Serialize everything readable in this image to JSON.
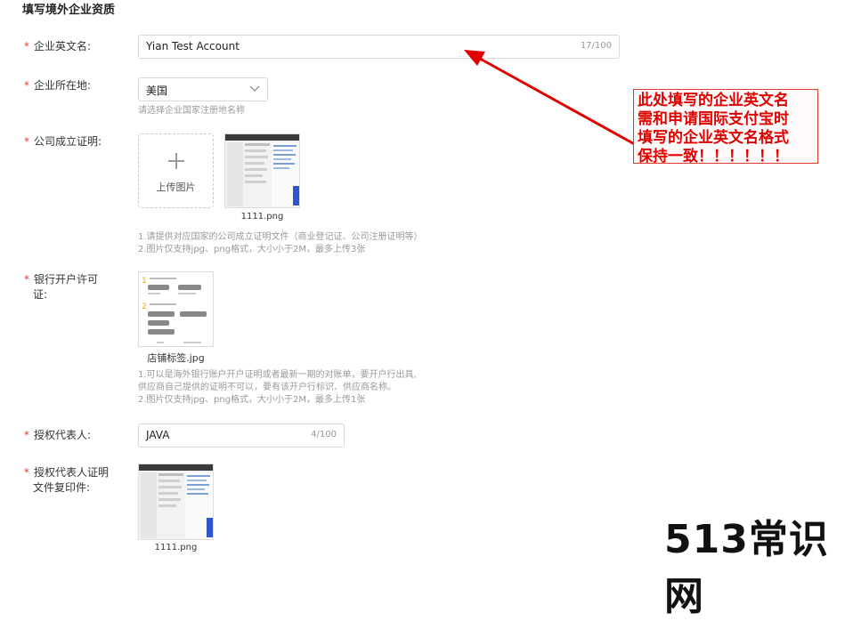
{
  "section_title": "填写境外企业资质",
  "required_mark": "*",
  "fields": {
    "english_name": {
      "label": "企业英文名:",
      "value": "Yian Test Account",
      "count": "17/100"
    },
    "location": {
      "label": "企业所在地:",
      "value": "美国",
      "hint": "请选择企业国家注册地名称"
    },
    "incorporation": {
      "label": "公司成立证明:",
      "upload_label": "上传图片",
      "file_name": "1111.png",
      "hint1": "1.请提供对应国家的公司成立证明文件（商业登记证、公司注册证明等）",
      "hint2": "2.图片仅支持jpg、png格式，大小小于2M，最多上传3张"
    },
    "bank": {
      "label_line1": "银行开户许可",
      "label_line2": "证:",
      "file_name": "店铺标签.jpg",
      "hint1": "1.可以是海外银行账户开户证明或者最新一期的对账单，要开户行出具,",
      "hint2": "供应商自己提供的证明不可以，要有该开户行标识、供应商名称。",
      "hint3": "2.图片仅支持jpg、png格式，大小小于2M，最多上传1张"
    },
    "representative": {
      "label": "授权代表人:",
      "value": "JAVA",
      "count": "4/100"
    },
    "rep_document": {
      "label_line1": "授权代表人证明",
      "label_line2": "文件复印件:",
      "file_name": "1111.png"
    }
  },
  "annotation": {
    "line1": "此处填写的企业英文名",
    "line2": "需和申请国际支付宝时",
    "line3": "填写的企业英文名格式",
    "line4": "保持一致！！！！！！",
    "color": "#e00000"
  },
  "watermark": "513常识网",
  "colors": {
    "required": "#e4393c",
    "border": "#d9d9d9",
    "hint": "#999999"
  }
}
